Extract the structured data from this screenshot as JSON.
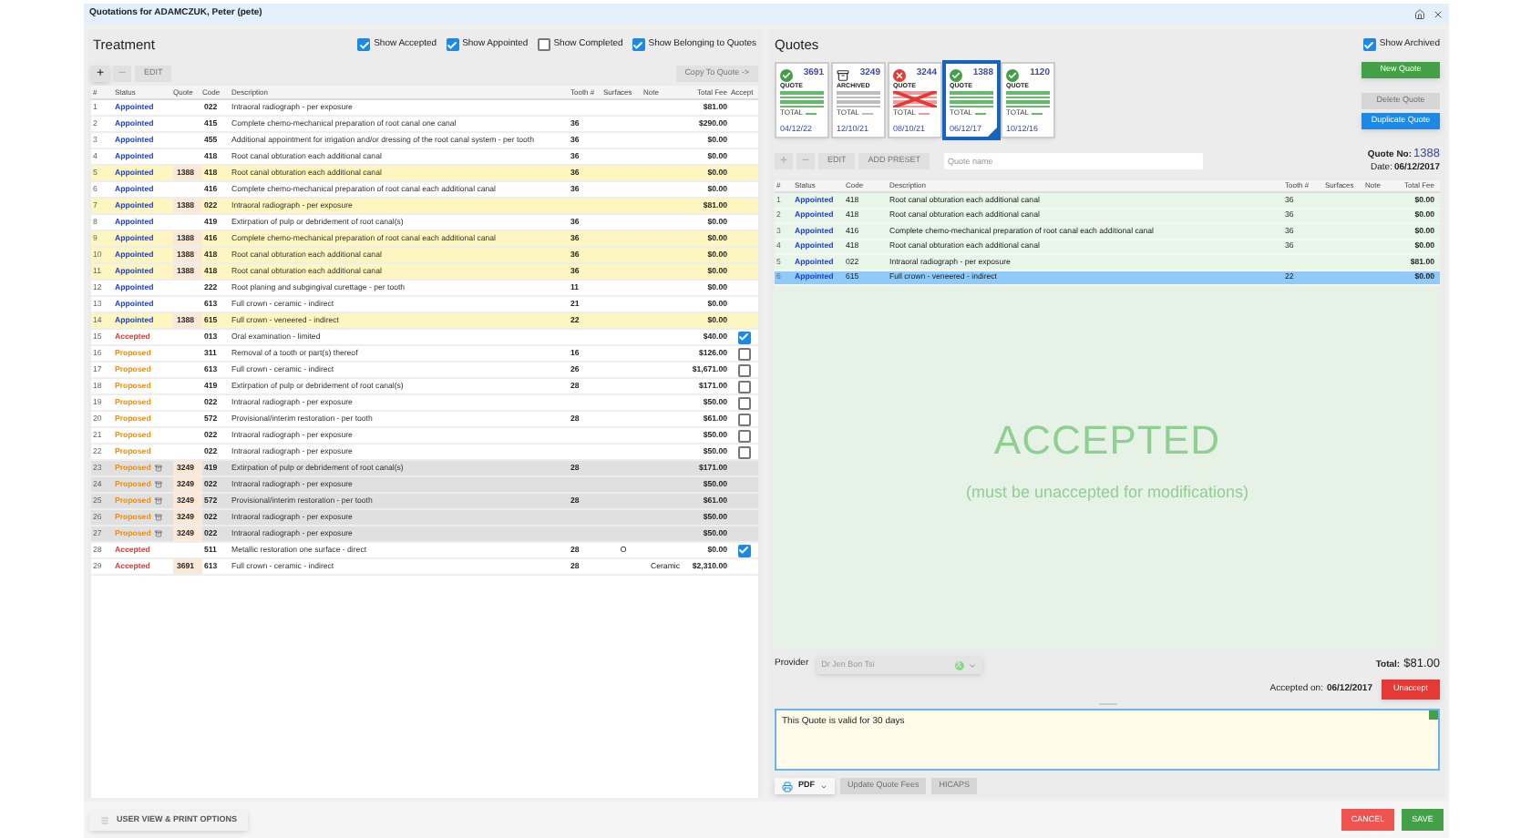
{
  "window": {
    "title": "Quotations for ADAMCZUK, Peter (pete)"
  },
  "treatment": {
    "title": "Treatment",
    "filters": [
      {
        "label": "Show Accepted",
        "checked": true
      },
      {
        "label": "Show Appointed",
        "checked": true
      },
      {
        "label": "Show Completed",
        "checked": false
      },
      {
        "label": "Show Belonging to Quotes",
        "checked": true
      }
    ],
    "toolbar": {
      "add": "+",
      "remove": "−",
      "edit": "EDIT",
      "copy": "Copy To Quote ->"
    },
    "columns": [
      "#",
      "Status",
      "Quote",
      "Code",
      "Description",
      "Tooth #",
      "Surfaces",
      "Note",
      "Total Fee",
      "Accept"
    ],
    "rows": [
      {
        "n": "1",
        "status": "Appointed",
        "kind": "appointed",
        "quote": "",
        "code": "022",
        "desc": "Intraoral radiograph - per exposure",
        "tooth": "",
        "surf": "",
        "note": "",
        "fee": "$81.00",
        "in_selected_quote": false,
        "archived": false
      },
      {
        "n": "2",
        "status": "Appointed",
        "kind": "appointed",
        "quote": "",
        "code": "415",
        "desc": "Complete chemo-mechanical preparation of root canal one canal",
        "tooth": "36",
        "surf": "",
        "note": "",
        "fee": "$290.00",
        "in_selected_quote": false,
        "archived": false
      },
      {
        "n": "3",
        "status": "Appointed",
        "kind": "appointed",
        "quote": "",
        "code": "455",
        "desc": "Additional appointment for irrigation and/or dressing of the root canal system - per tooth",
        "tooth": "36",
        "surf": "",
        "note": "",
        "fee": "$0.00",
        "in_selected_quote": false,
        "archived": false
      },
      {
        "n": "4",
        "status": "Appointed",
        "kind": "appointed",
        "quote": "",
        "code": "418",
        "desc": "Root canal obturation each additional canal",
        "tooth": "36",
        "surf": "",
        "note": "",
        "fee": "$0.00",
        "in_selected_quote": false,
        "archived": false
      },
      {
        "n": "5",
        "status": "Appointed",
        "kind": "appointed",
        "quote": "1388",
        "code": "418",
        "desc": "Root canal obturation each additional canal",
        "tooth": "36",
        "surf": "",
        "note": "",
        "fee": "$0.00",
        "in_selected_quote": true,
        "archived": false
      },
      {
        "n": "6",
        "status": "Appointed",
        "kind": "appointed",
        "quote": "",
        "code": "416",
        "desc": "Complete chemo-mechanical preparation of root canal each additional canal",
        "tooth": "36",
        "surf": "",
        "note": "",
        "fee": "$0.00",
        "in_selected_quote": false,
        "archived": false
      },
      {
        "n": "7",
        "status": "Appointed",
        "kind": "appointed",
        "quote": "1388",
        "code": "022",
        "desc": "Intraoral radiograph - per exposure",
        "tooth": "",
        "surf": "",
        "note": "",
        "fee": "$81.00",
        "in_selected_quote": true,
        "archived": false
      },
      {
        "n": "8",
        "status": "Appointed",
        "kind": "appointed",
        "quote": "",
        "code": "419",
        "desc": "Extirpation of pulp or debridement of root canal(s)",
        "tooth": "36",
        "surf": "",
        "note": "",
        "fee": "$0.00",
        "in_selected_quote": false,
        "archived": false
      },
      {
        "n": "9",
        "status": "Appointed",
        "kind": "appointed",
        "quote": "1388",
        "code": "416",
        "desc": "Complete chemo-mechanical preparation of root canal each additional canal",
        "tooth": "36",
        "surf": "",
        "note": "",
        "fee": "$0.00",
        "in_selected_quote": true,
        "archived": false
      },
      {
        "n": "10",
        "status": "Appointed",
        "kind": "appointed",
        "quote": "1388",
        "code": "418",
        "desc": "Root canal obturation each additional canal",
        "tooth": "36",
        "surf": "",
        "note": "",
        "fee": "$0.00",
        "in_selected_quote": true,
        "archived": false
      },
      {
        "n": "11",
        "status": "Appointed",
        "kind": "appointed",
        "quote": "1388",
        "code": "418",
        "desc": "Root canal obturation each additional canal",
        "tooth": "36",
        "surf": "",
        "note": "",
        "fee": "$0.00",
        "in_selected_quote": true,
        "archived": false
      },
      {
        "n": "12",
        "status": "Appointed",
        "kind": "appointed",
        "quote": "",
        "code": "222",
        "desc": "Root planing and subgingival curettage - per tooth",
        "tooth": "11",
        "surf": "",
        "note": "",
        "fee": "$0.00",
        "in_selected_quote": false,
        "archived": false
      },
      {
        "n": "13",
        "status": "Appointed",
        "kind": "appointed",
        "quote": "",
        "code": "613",
        "desc": "Full crown - ceramic - indirect",
        "tooth": "21",
        "surf": "",
        "note": "",
        "fee": "$0.00",
        "in_selected_quote": false,
        "archived": false
      },
      {
        "n": "14",
        "status": "Appointed",
        "kind": "appointed",
        "quote": "1388",
        "code": "615",
        "desc": "Full crown - veneered - indirect",
        "tooth": "22",
        "surf": "",
        "note": "",
        "fee": "$0.00",
        "in_selected_quote": true,
        "archived": false
      },
      {
        "n": "15",
        "status": "Accepted",
        "kind": "accepted",
        "quote": "",
        "code": "013",
        "desc": "Oral examination - limited",
        "tooth": "",
        "surf": "",
        "note": "",
        "fee": "$40.00",
        "in_selected_quote": false,
        "archived": false,
        "checked": true
      },
      {
        "n": "16",
        "status": "Proposed",
        "kind": "proposed",
        "quote": "",
        "code": "311",
        "desc": "Removal of a tooth or part(s) thereof",
        "tooth": "16",
        "surf": "",
        "note": "",
        "fee": "$126.00",
        "in_selected_quote": false,
        "archived": false,
        "checked": false
      },
      {
        "n": "17",
        "status": "Proposed",
        "kind": "proposed",
        "quote": "",
        "code": "613",
        "desc": "Full crown - ceramic - indirect",
        "tooth": "26",
        "surf": "",
        "note": "",
        "fee": "$1,671.00",
        "in_selected_quote": false,
        "archived": false,
        "checked": false
      },
      {
        "n": "18",
        "status": "Proposed",
        "kind": "proposed",
        "quote": "",
        "code": "419",
        "desc": "Extirpation of pulp or debridement of root canal(s)",
        "tooth": "28",
        "surf": "",
        "note": "",
        "fee": "$171.00",
        "in_selected_quote": false,
        "archived": false,
        "checked": false
      },
      {
        "n": "19",
        "status": "Proposed",
        "kind": "proposed",
        "quote": "",
        "code": "022",
        "desc": "Intraoral radiograph - per exposure",
        "tooth": "",
        "surf": "",
        "note": "",
        "fee": "$50.00",
        "in_selected_quote": false,
        "archived": false,
        "checked": false
      },
      {
        "n": "20",
        "status": "Proposed",
        "kind": "proposed",
        "quote": "",
        "code": "572",
        "desc": "Provisional/interim restoration - per tooth",
        "tooth": "28",
        "surf": "",
        "note": "",
        "fee": "$61.00",
        "in_selected_quote": false,
        "archived": false,
        "checked": false
      },
      {
        "n": "21",
        "status": "Proposed",
        "kind": "proposed",
        "quote": "",
        "code": "022",
        "desc": "Intraoral radiograph - per exposure",
        "tooth": "",
        "surf": "",
        "note": "",
        "fee": "$50.00",
        "in_selected_quote": false,
        "archived": false,
        "checked": false
      },
      {
        "n": "22",
        "status": "Proposed",
        "kind": "proposed",
        "quote": "",
        "code": "022",
        "desc": "Intraoral radiograph - per exposure",
        "tooth": "",
        "surf": "",
        "note": "",
        "fee": "$50.00",
        "in_selected_quote": false,
        "archived": false,
        "checked": false
      },
      {
        "n": "23",
        "status": "Proposed",
        "kind": "proposed",
        "quote": "3249",
        "code": "419",
        "desc": "Extirpation of pulp or debridement of root canal(s)",
        "tooth": "28",
        "surf": "",
        "note": "",
        "fee": "$171.00",
        "in_selected_quote": false,
        "archived": true
      },
      {
        "n": "24",
        "status": "Proposed",
        "kind": "proposed",
        "quote": "3249",
        "code": "022",
        "desc": "Intraoral radiograph - per exposure",
        "tooth": "",
        "surf": "",
        "note": "",
        "fee": "$50.00",
        "in_selected_quote": false,
        "archived": true
      },
      {
        "n": "25",
        "status": "Proposed",
        "kind": "proposed",
        "quote": "3249",
        "code": "572",
        "desc": "Provisional/interim restoration - per tooth",
        "tooth": "28",
        "surf": "",
        "note": "",
        "fee": "$61.00",
        "in_selected_quote": false,
        "archived": true
      },
      {
        "n": "26",
        "status": "Proposed",
        "kind": "proposed",
        "quote": "3249",
        "code": "022",
        "desc": "Intraoral radiograph - per exposure",
        "tooth": "",
        "surf": "",
        "note": "",
        "fee": "$50.00",
        "in_selected_quote": false,
        "archived": true
      },
      {
        "n": "27",
        "status": "Proposed",
        "kind": "proposed",
        "quote": "3249",
        "code": "022",
        "desc": "Intraoral radiograph - per exposure",
        "tooth": "",
        "surf": "",
        "note": "",
        "fee": "$50.00",
        "in_selected_quote": false,
        "archived": true
      },
      {
        "n": "28",
        "status": "Accepted",
        "kind": "accepted",
        "quote": "",
        "code": "511",
        "desc": "Metallic restoration one surface - direct",
        "tooth": "28",
        "surf": "O",
        "note": "",
        "fee": "$0.00",
        "in_selected_quote": false,
        "archived": false,
        "checked": true
      },
      {
        "n": "29",
        "status": "Accepted",
        "kind": "accepted",
        "quote": "3691",
        "code": "613",
        "desc": "Full crown - ceramic - indirect",
        "tooth": "28",
        "surf": "",
        "note": "Ceramic",
        "fee": "$2,310.00",
        "in_selected_quote": false,
        "archived": false
      }
    ]
  },
  "quotes": {
    "title": "Quotes",
    "show_archived": {
      "label": "Show Archived",
      "checked": true
    },
    "cards": [
      {
        "number": "3691",
        "kind": "accepted",
        "label": "QUOTE",
        "total": "TOTAL",
        "date": "04/12/22",
        "selected": false
      },
      {
        "number": "3249",
        "kind": "archived",
        "label": "ARCHIVED",
        "total": "TOTAL",
        "date": "12/10/21",
        "selected": false
      },
      {
        "number": "3244",
        "kind": "rejected",
        "label": "QUOTE",
        "total": "TOTAL",
        "date": "08/10/21",
        "selected": false
      },
      {
        "number": "1388",
        "kind": "accepted",
        "label": "QUOTE",
        "total": "TOTAL",
        "date": "06/12/17",
        "selected": true
      },
      {
        "number": "1120",
        "kind": "accepted",
        "label": "QUOTE",
        "total": "TOTAL",
        "date": "10/12/16",
        "selected": false
      }
    ],
    "buttons": {
      "new": "New Quote",
      "delete": "Delete Quote",
      "duplicate": "Duplicate Quote"
    },
    "toolbar": {
      "add": "+",
      "remove": "−",
      "edit": "EDIT",
      "preset": "ADD PRESET",
      "name_placeholder": "Quote name"
    },
    "quote_no_label": "Quote No:",
    "quote_no": "1388",
    "date_label": "Date:",
    "date": "06/12/2017",
    "columns": [
      "#",
      "Status",
      "Code",
      "Description",
      "Tooth #",
      "Surfaces",
      "Note",
      "Total Fee"
    ],
    "rows": [
      {
        "n": "1",
        "status": "Appointed",
        "code": "418",
        "desc": "Root canal obturation each additional canal",
        "tooth": "36",
        "fee": "$0.00",
        "selected": false
      },
      {
        "n": "2",
        "status": "Appointed",
        "code": "418",
        "desc": "Root canal obturation each additional canal",
        "tooth": "36",
        "fee": "$0.00",
        "selected": false
      },
      {
        "n": "3",
        "status": "Appointed",
        "code": "416",
        "desc": "Complete chemo-mechanical preparation of root canal each additional canal",
        "tooth": "36",
        "fee": "$0.00",
        "selected": false
      },
      {
        "n": "4",
        "status": "Appointed",
        "code": "418",
        "desc": "Root canal obturation each additional canal",
        "tooth": "36",
        "fee": "$0.00",
        "selected": false
      },
      {
        "n": "5",
        "status": "Appointed",
        "code": "022",
        "desc": "Intraoral radiograph - per exposure",
        "tooth": "",
        "fee": "$81.00",
        "selected": false
      },
      {
        "n": "6",
        "status": "Appointed",
        "code": "615",
        "desc": "Full crown - veneered - indirect",
        "tooth": "22",
        "fee": "$0.00",
        "selected": true
      }
    ],
    "watermark": "ACCEPTED",
    "watermark_note": "(must be unaccepted for modifications)",
    "provider_label": "Provider",
    "provider": "Dr Jen Bon Tsi",
    "total_label": "Total:",
    "total": "$81.00",
    "accepted_label": "Accepted on:",
    "accepted_date": "06/12/2017",
    "unaccept": "Unaccept",
    "notes": "This Quote is valid for 30 days",
    "pdf": "PDF",
    "update_fees": "Update Quote Fees",
    "hicaps": "HICAPS"
  },
  "footer": {
    "options": "USER VIEW & PRINT OPTIONS",
    "cancel": "CANCEL",
    "save": "SAVE"
  }
}
